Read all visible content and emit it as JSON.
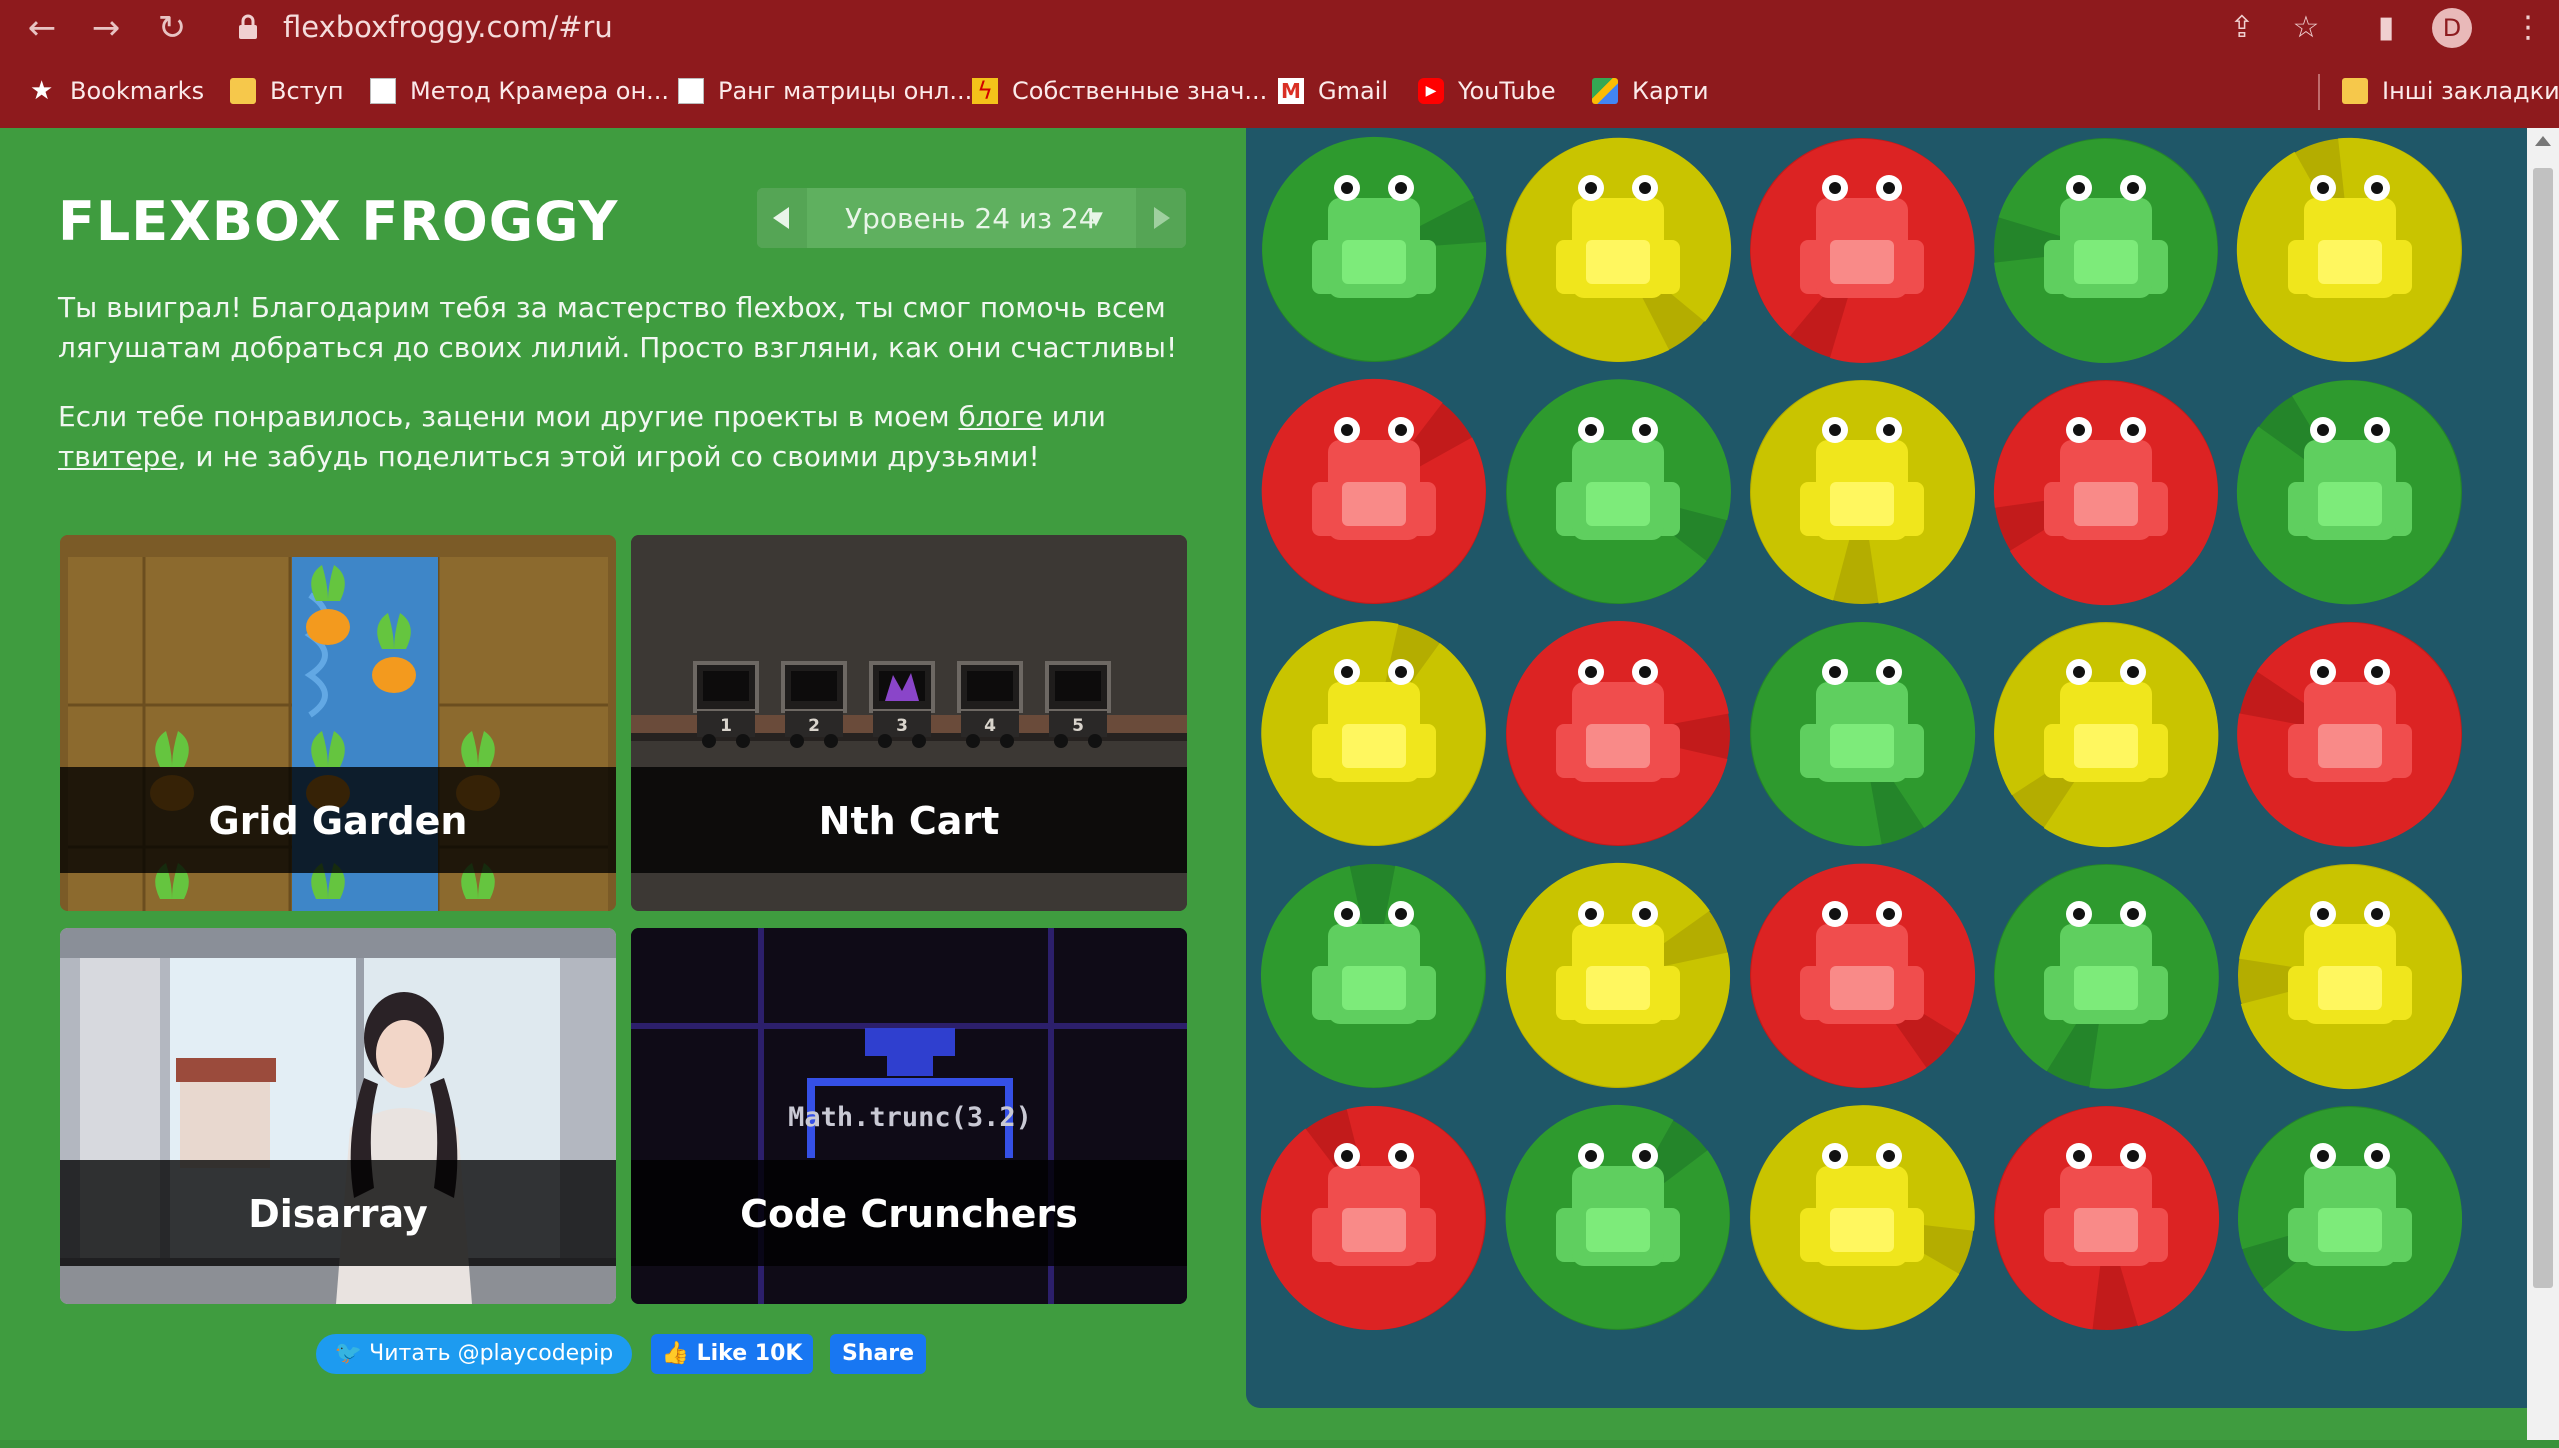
{
  "browser": {
    "url": "flexboxfroggy.com/#ru",
    "avatar_letter": "D",
    "bookmarks": [
      {
        "label": "Bookmarks",
        "icon": "star-icon"
      },
      {
        "label": "Вступ",
        "icon": "folder-icon"
      },
      {
        "label": "Метод Крамера он...",
        "icon": "page-icon"
      },
      {
        "label": "Ранг матрицы онл...",
        "icon": "page-icon"
      },
      {
        "label": "Собственные знач...",
        "icon": "bolt-icon"
      },
      {
        "label": "Gmail",
        "icon": "gmail-icon"
      },
      {
        "label": "YouTube",
        "icon": "youtube-icon"
      },
      {
        "label": "Карти",
        "icon": "maps-icon"
      }
    ],
    "other_bookmarks": "Інші закладки"
  },
  "game": {
    "logo": "FLEXBOX FROGGY",
    "level_label": "Уровень 24 из 24",
    "para1": "Ты выиграл! Благодарим тебя за мастерство flexbox, ты смог помочь всем лягушатам добраться до своих лилий. Просто взгляни, как они счастливы!",
    "para2_a": "Если тебе понравилось, зацени мои другие проекты в моем ",
    "link_blog": "блоге",
    "para2_b": " или ",
    "link_twitter": "твитере",
    "para2_c": ", и не забудь поделиться этой игрой со своими друзьями!",
    "cards": [
      {
        "title": "Grid Garden"
      },
      {
        "title": "Nth Cart"
      },
      {
        "title": "Disarray"
      },
      {
        "title": "Code Crunchers"
      }
    ],
    "code_cruncher_text": "Math.trunc(3.2)",
    "cart_numbers": [
      "1",
      "2",
      "3",
      "4",
      "5"
    ],
    "social": {
      "twitter": "Читать @playcodepip",
      "like": "Like 10K",
      "share": "Share"
    }
  },
  "pond": {
    "colors": {
      "green": "#2e9a2e",
      "yellow": "#c9c400",
      "red": "#dc2323"
    },
    "grid": [
      [
        "green",
        "yellow",
        "red",
        "green",
        "yellow"
      ],
      [
        "red",
        "green",
        "yellow",
        "red",
        "green"
      ],
      [
        "yellow",
        "red",
        "green",
        "yellow",
        "red"
      ],
      [
        "green",
        "yellow",
        "red",
        "green",
        "yellow"
      ],
      [
        "red",
        "green",
        "yellow",
        "red",
        "green"
      ]
    ]
  }
}
